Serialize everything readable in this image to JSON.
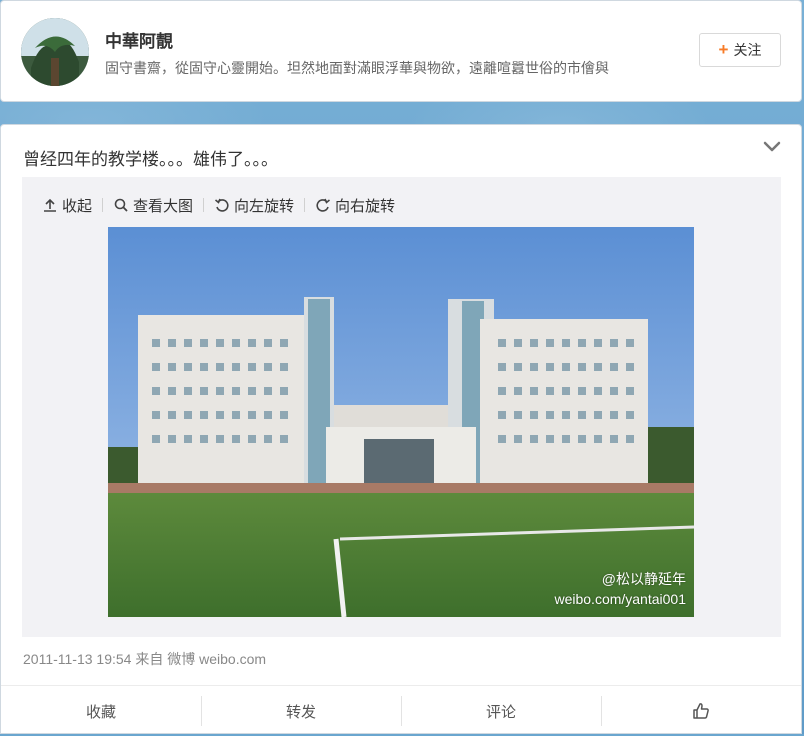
{
  "profile": {
    "name": "中華阿靚",
    "bio": "固守書齋，從固守心靈開始。坦然地面對滿眼浮華與物欲，遠離喧囂世俗的市儈與",
    "follow_label": "关注"
  },
  "post": {
    "text": "曾经四年的教学楼。。。雄伟了。。。",
    "toolbar": {
      "collapse": "收起",
      "view_large": "查看大图",
      "rotate_left": "向左旋转",
      "rotate_right": "向右旋转"
    },
    "image": {
      "watermark_user": "@松以静延年",
      "watermark_url": "weibo.com/yantai001"
    },
    "timestamp": "2011-11-13 19:54 来自 微博 weibo.com"
  },
  "actions": {
    "favorite": "收藏",
    "repost": "转发",
    "comment": "评论"
  },
  "icons": [
    "chevron-down-icon",
    "upload-icon",
    "search-icon",
    "rotate-left-icon",
    "rotate-right-icon",
    "thumbs-up-icon",
    "plus-icon"
  ],
  "colors": {
    "accent": "#f77b27",
    "background": "#6aa6cf"
  }
}
